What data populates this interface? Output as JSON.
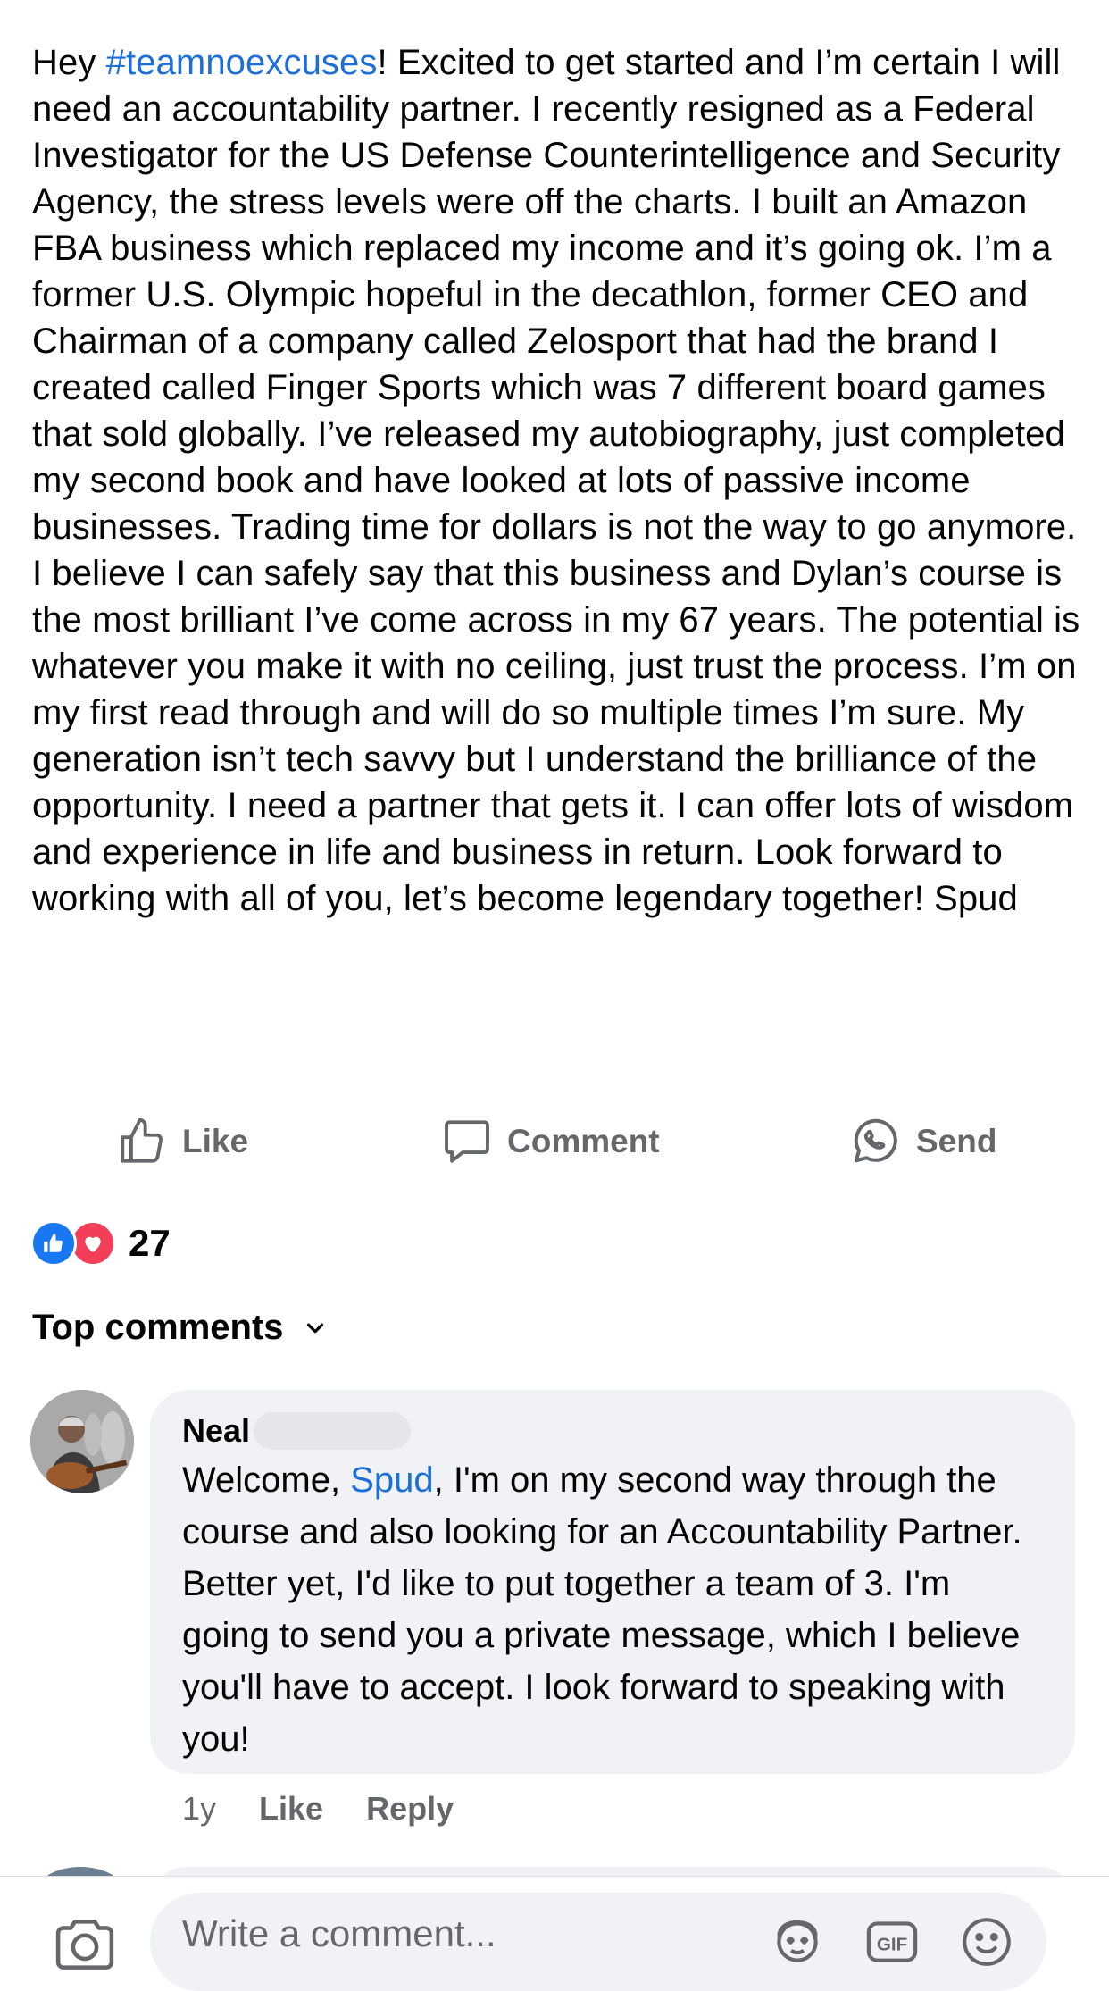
{
  "post": {
    "hashtag_prefix": "Hey ",
    "hashtag": "#teamnoexcuses",
    "text": "! Excited to get started and I’m certain I will need an accountability partner. I recently resigned as a Federal Investigator for the US Defense Counterintelligence and Security Agency, the stress levels were off the charts. I built an Amazon FBA business which replaced my income and it’s going ok. I’m a former U.S. Olympic hopeful in the decathlon, former CEO and Chairman of a company called Zelosport that had the brand I created called Finger Sports which was 7 different board games that sold globally. I’ve released my autobiography, just completed my second book and have looked at lots of passive income businesses. Trading time for dollars is not the way to go anymore. I believe I can safely say that this business and Dylan’s course is the most brilliant I’ve come across in my 67 years. The potential is whatever you make it with no ceiling, just trust the process. I’m on my first read through and will do so multiple times I’m sure. My generation isn’t tech savvy but I understand the brilliance of the opportunity. I need a partner that gets it. I can offer lots of wisdom and experience in life and business in return. Look forward to working with all of you, let’s become legendary together! Spud"
  },
  "actions": {
    "like": "Like",
    "comment": "Comment",
    "send": "Send"
  },
  "reactions": {
    "count": "27",
    "types": [
      "like",
      "love"
    ]
  },
  "comments_header": "Top comments",
  "comment": {
    "author": "Neal",
    "text_before_mention": "Welcome, ",
    "mention": "Spud",
    "text_after_mention": ", I'm on my second way through the course and also looking for an Accountability Partner. Better yet, I'd like to put together a team of 3. I'm going to send you a private message, which I believe you'll have to accept. I look forward to speaking with you!",
    "time": "1y",
    "like_label": "Like",
    "reply_label": "Reply"
  },
  "composer": {
    "placeholder": "Write a comment..."
  },
  "colors": {
    "link": "#1b6fd6",
    "like_blue": "#1877f2",
    "love_red": "#f33e58",
    "secondary_text": "#65676b",
    "bubble_bg": "#f0f2f5"
  }
}
